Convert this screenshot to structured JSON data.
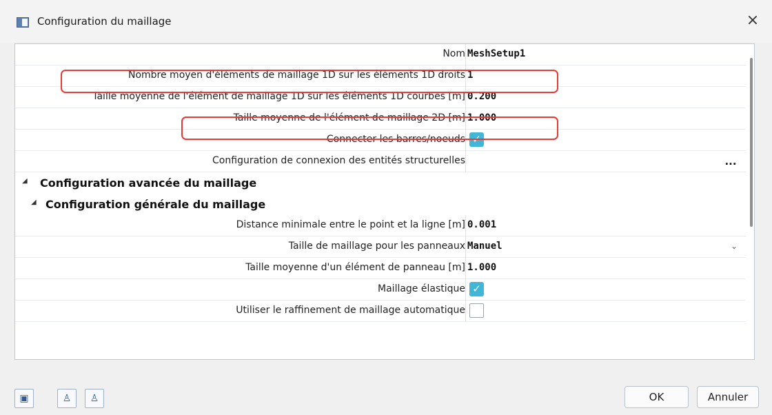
{
  "window": {
    "title": "Configuration du maillage"
  },
  "properties": [
    {
      "label": "Nom",
      "value": "MeshSetup1"
    },
    {
      "label": "Nombre moyen d'éléments de maillage 1D sur les éléments 1D droits",
      "value": "1"
    },
    {
      "label": "Taille moyenne de l'élément de maillage 1D sur les éléments 1D courbes [m]",
      "value": "0.200"
    },
    {
      "label": "Taille moyenne de l'élément de maillage 2D [m]",
      "value": "1.000"
    },
    {
      "label": "Connecter les barres/noeuds",
      "value": "checked"
    },
    {
      "label": "Configuration de connexion des entités structurelles",
      "value": "..."
    }
  ],
  "sections": {
    "advanced": "Configuration avancée du maillage",
    "general": "Configuration générale du maillage"
  },
  "general_properties": [
    {
      "label": "Distance minimale entre le point et la ligne [m]",
      "value": "0.001"
    },
    {
      "label": "Taille de maillage pour les panneaux",
      "value": "Manuel"
    },
    {
      "label": "Taille moyenne d'un élément de panneau [m]",
      "value": "1.000"
    },
    {
      "label": "Maillage élastique",
      "value": "checked"
    },
    {
      "label": "Utiliser le raffinement de maillage automatique",
      "value": "unchecked"
    }
  ],
  "buttons": {
    "ok": "OK",
    "cancel": "Annuler"
  },
  "icons": {
    "window": "app-window-icon",
    "close": "close-icon",
    "expand": "triangle-down-icon",
    "dropdown": "chevron-down-icon",
    "more": "ellipsis-icon"
  }
}
